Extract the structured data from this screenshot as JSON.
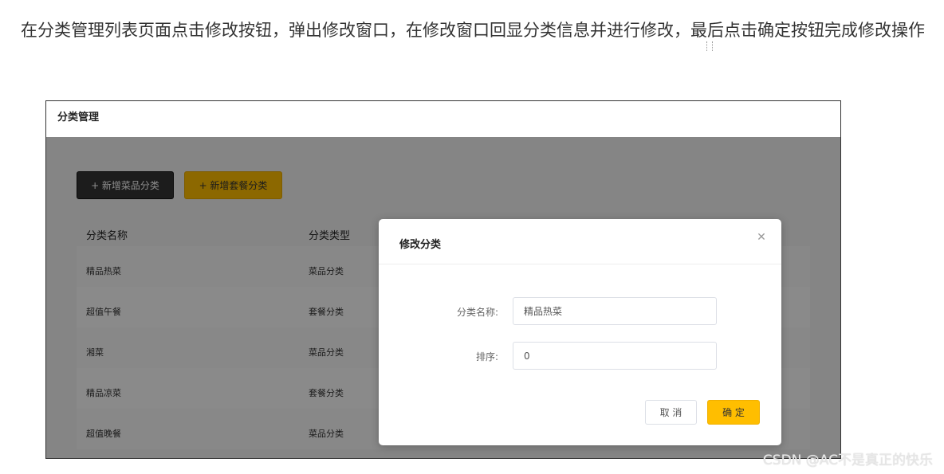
{
  "instruction": {
    "text": "在分类管理列表页面点击修改按钮，弹出修改窗口，在修改窗口回显分类信息并进行修改，最后点击确定按钮完成修改操作"
  },
  "screenshot": {
    "header_title": "分类管理",
    "buttons": {
      "add_dish_category": "+ 新增菜品分类",
      "add_setmeal_category": "+ 新增套餐分类"
    },
    "table": {
      "columns": [
        "分类名称",
        "分类类型"
      ],
      "rows": [
        {
          "name": "精品热菜",
          "type": "菜品分类"
        },
        {
          "name": "超值午餐",
          "type": "套餐分类"
        },
        {
          "name": "湘菜",
          "type": "菜品分类"
        },
        {
          "name": "精品凉菜",
          "type": "套餐分类"
        },
        {
          "name": "超值晚餐",
          "type": "菜品分类"
        }
      ]
    },
    "dialog": {
      "title": "修改分类",
      "fields": [
        {
          "label": "分类名称:",
          "value": "精品热菜"
        },
        {
          "label": "排序:",
          "value": "0"
        }
      ],
      "cancel_label": "取 消",
      "confirm_label": "确 定"
    },
    "colors": {
      "primary": "#ffbe00",
      "dark_button": "#333333",
      "overlay": "rgba(0,0,0,0.45)"
    }
  },
  "watermark": "CSDN @AC不是真正的快乐"
}
